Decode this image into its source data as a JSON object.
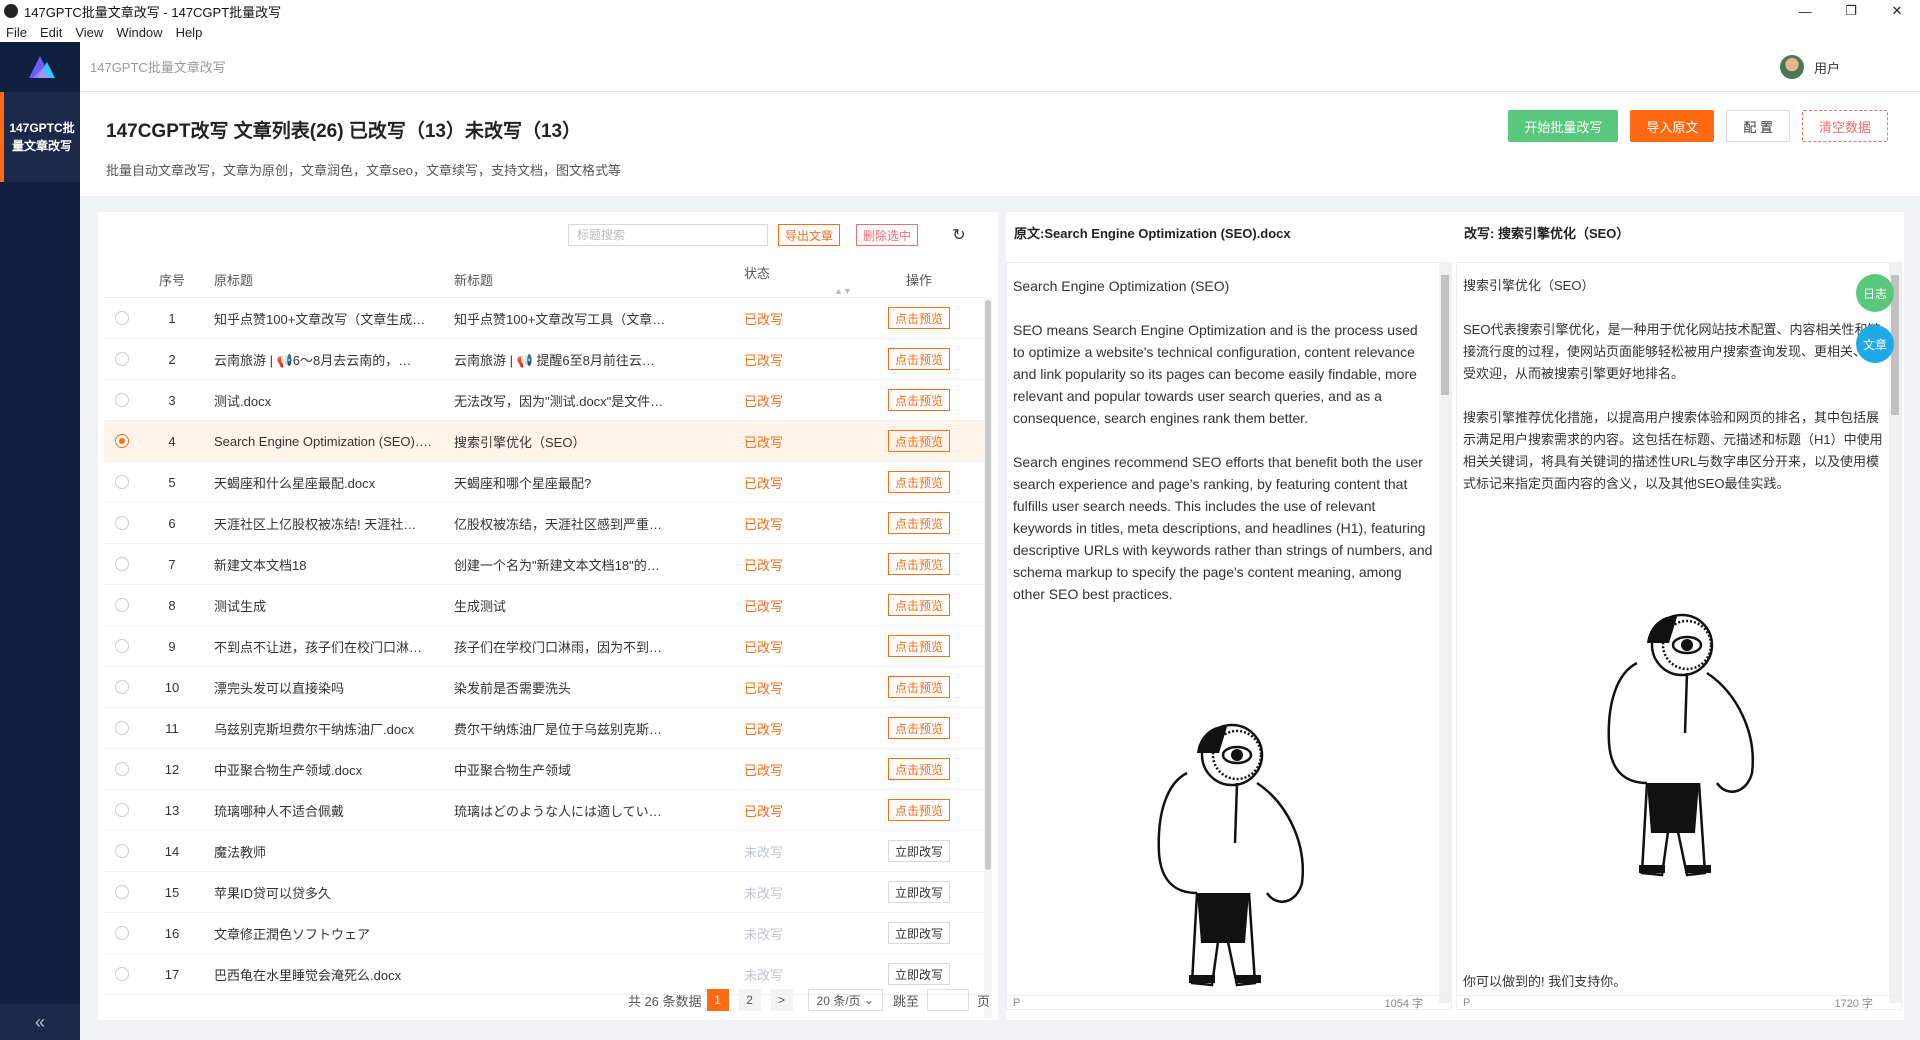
{
  "window": {
    "title": "147GPTC批量文章改写 - 147CGPT批量改写",
    "minimize": "—",
    "maximize": "❐",
    "close": "✕"
  },
  "menu": [
    "File",
    "Edit",
    "View",
    "Window",
    "Help"
  ],
  "sidebar": {
    "nav_label": "147GPTC批量文章改写",
    "collapse": "«"
  },
  "header": {
    "breadcrumb": "147GPTC批量文章改写",
    "user": "用户"
  },
  "page": {
    "title": "147CGPT改写 文章列表(26) 已改写（13）未改写（13）",
    "subtitle": "批量自动文章改写，文章为原创，文章润色，文章seo，文章续写，支持文档，图文格式等",
    "buttons": {
      "start": "开始批量改写",
      "import": "导入原文",
      "config": "配 置",
      "clear": "清空数据"
    }
  },
  "list": {
    "search_placeholder": "标题搜索",
    "export": "导出文章",
    "delete": "删除选中",
    "refresh_icon": "↻",
    "columns": {
      "idx": "序号",
      "orig": "原标题",
      "new": "新标题",
      "status": "状态",
      "op": "操作",
      "sort": "▲▼"
    },
    "rows": [
      {
        "idx": "1",
        "orig": "知乎点赞100+文章改写（文章生成…",
        "new": "知乎点赞100+文章改写工具（文章…",
        "status": "已改写",
        "op": "点击预览"
      },
      {
        "idx": "2",
        "orig": "云南旅游 | 📢6～8月去云南的，…",
        "new": "云南旅游 | 📢 提醒6至8月前往云…",
        "status": "已改写",
        "op": "点击预览"
      },
      {
        "idx": "3",
        "orig": "测试.docx",
        "new": "无法改写，因为\"测试.docx\"是文件…",
        "status": "已改写",
        "op": "点击预览"
      },
      {
        "idx": "4",
        "orig": "Search Engine Optimization (SEO)….",
        "new": "搜索引擎优化（SEO）",
        "status": "已改写",
        "op": "点击预览"
      },
      {
        "idx": "5",
        "orig": "天蝎座和什么星座最配.docx",
        "new": "天蝎座和哪个星座最配?",
        "status": "已改写",
        "op": "点击预览"
      },
      {
        "idx": "6",
        "orig": "天涯社区上亿股权被冻结! 天涯社…",
        "new": "亿股权被冻结，天涯社区感到严重…",
        "status": "已改写",
        "op": "点击预览"
      },
      {
        "idx": "7",
        "orig": "新建文本文档18",
        "new": "创建一个名为\"新建文本文档18\"的…",
        "status": "已改写",
        "op": "点击预览"
      },
      {
        "idx": "8",
        "orig": "测试生成",
        "new": "生成测试",
        "status": "已改写",
        "op": "点击预览"
      },
      {
        "idx": "9",
        "orig": "不到点不让进，孩子们在校门口淋…",
        "new": "孩子们在学校门口淋雨，因为不到…",
        "status": "已改写",
        "op": "点击预览"
      },
      {
        "idx": "10",
        "orig": "漂完头发可以直接染吗",
        "new": "染发前是否需要洗头",
        "status": "已改写",
        "op": "点击预览"
      },
      {
        "idx": "11",
        "orig": "乌兹别克斯坦费尔干纳炼油厂.docx",
        "new": "费尔干纳炼油厂是位于乌兹别克斯…",
        "status": "已改写",
        "op": "点击预览"
      },
      {
        "idx": "12",
        "orig": "中亚聚合物生产领域.docx",
        "new": "中亚聚合物生产领域",
        "status": "已改写",
        "op": "点击预览"
      },
      {
        "idx": "13",
        "orig": "琉璃哪种人不适合佩戴",
        "new": "琉璃はどのような人には適してい…",
        "status": "已改写",
        "op": "点击预览"
      },
      {
        "idx": "14",
        "orig": "魔法教师",
        "new": "",
        "status": "未改写",
        "op": "立即改写"
      },
      {
        "idx": "15",
        "orig": "苹果ID贷可以贷多久",
        "new": "",
        "status": "未改写",
        "op": "立即改写"
      },
      {
        "idx": "16",
        "orig": "文章修正潤色ソフトウェア",
        "new": "",
        "status": "未改写",
        "op": "立即改写"
      },
      {
        "idx": "17",
        "orig": "巴西龟在水里睡觉会淹死么.docx",
        "new": "",
        "status": "未改写",
        "op": "立即改写"
      }
    ],
    "selected_index": 3,
    "pager": {
      "total": "共 26 条数据",
      "page1": "1",
      "page2": "2",
      "next": ">",
      "size": "20 条/页",
      "size_arrow": "⌄",
      "jump_label": "跳至",
      "page_suffix": "页"
    }
  },
  "compare": {
    "left_title": "原文:Search Engine Optimization (SEO).docx",
    "right_title": "改写: 搜索引擎优化（SEO）",
    "left_paragraphs": [
      "Search Engine Optimization (SEO)",
      "SEO means Search Engine Optimization and is the process used to optimize a website's technical configuration, content relevance and link popularity so its pages can become easily findable, more relevant and popular towards user search queries, and as a consequence, search engines rank them better.",
      "Search engines recommend SEO efforts that benefit both the user search experience and page’s ranking, by featuring content that fulfills user search needs. This includes the use of relevant keywords in titles, meta descriptions, and headlines (H1), featuring descriptive URLs with keywords rather than strings of numbers, and schema markup to specify the page's content meaning, among other SEO best practices."
    ],
    "right_paragraphs": [
      "搜索引擎优化（SEO）",
      "SEO代表搜索引擎优化，是一种用于优化网站技术配置、内容相关性和链接流行度的过程，使网站页面能够轻松被用户搜索查询发现、更相关、更受欢迎，从而被搜索引擎更好地排名。",
      "搜索引擎推荐优化措施，以提高用户搜索体验和网页的排名，其中包括展示满足用户搜索需求的内容。这包括在标题、元描述和标题（H1）中使用相关关键词，将具有关键词的描述性URL与数字串区分开来，以及使用模式标记来指定页面内容的含义，以及其他SEO最佳实践。"
    ],
    "right_end": "你可以做到的! 我们支持你。",
    "left_status": "P",
    "left_count": "1054 字",
    "right_status": "P",
    "right_count": "1720 字",
    "float_log": "日志",
    "float_article": "文章"
  }
}
